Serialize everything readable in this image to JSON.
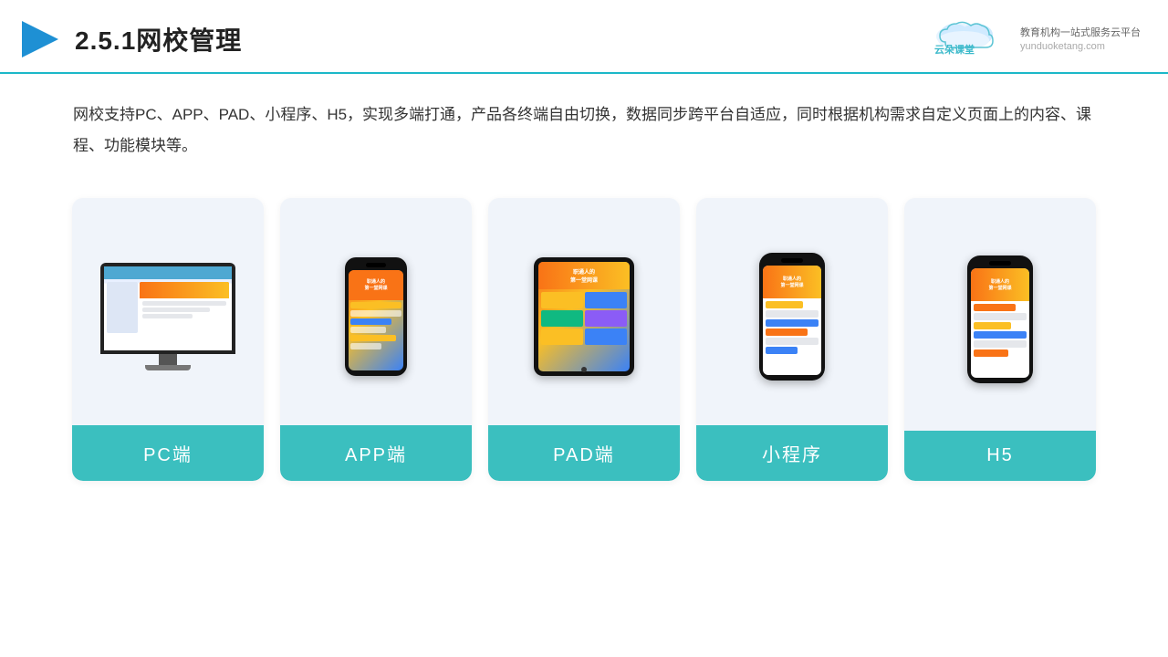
{
  "header": {
    "title": "2.5.1网校管理",
    "logo_name": "云朵课堂",
    "logo_url": "yunduoketang.com",
    "logo_slogan": "教育机构一站式服务云平台"
  },
  "description": {
    "text": "网校支持PC、APP、PAD、小程序、H5，实现多端打通，产品各终端自由切换，数据同步跨平台自适应，同时根据机构需求自定义页面上的内容、课程、功能模块等。"
  },
  "cards": [
    {
      "id": "pc",
      "label": "PC端"
    },
    {
      "id": "app",
      "label": "APP端"
    },
    {
      "id": "pad",
      "label": "PAD端"
    },
    {
      "id": "miniapp",
      "label": "小程序"
    },
    {
      "id": "h5",
      "label": "H5"
    }
  ],
  "colors": {
    "accent": "#3bbfbf",
    "header_line": "#1cb8c8",
    "card_bg": "#f0f4fa"
  }
}
